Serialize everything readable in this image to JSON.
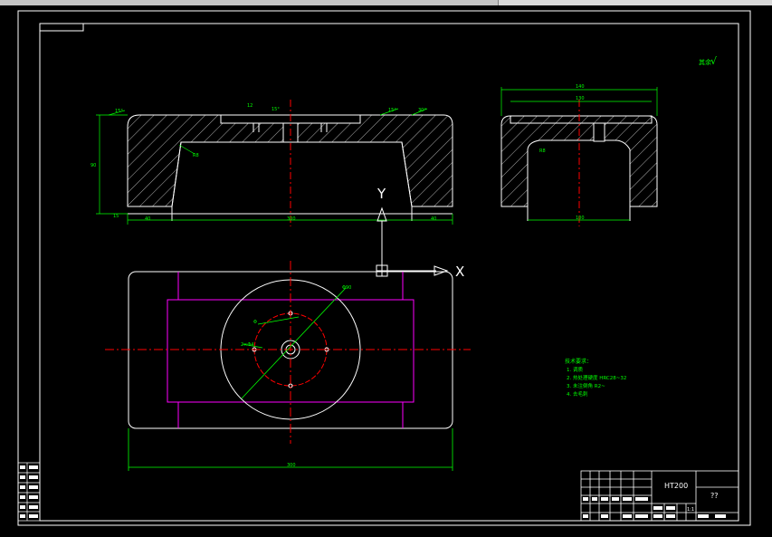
{
  "title_block": {
    "material": "HT200",
    "drawing_name": "??",
    "scale": "1:1"
  },
  "surface_finish": {
    "label": "其余",
    "mark": "√"
  },
  "ucs": {
    "y_label": "Y",
    "x_label": "X"
  },
  "tech_notes": {
    "heading": "技术要求：",
    "lines": [
      "1. 调质",
      "2. 热处理硬度 HRC28~32",
      "3. 未注倒角 R2~",
      "4. 去毛刺"
    ]
  },
  "colors": {
    "outline": "#ffffff",
    "dimension": "#00ff00",
    "centerline": "#ff0000",
    "hidden": "#ff00ff",
    "background": "#000000"
  }
}
